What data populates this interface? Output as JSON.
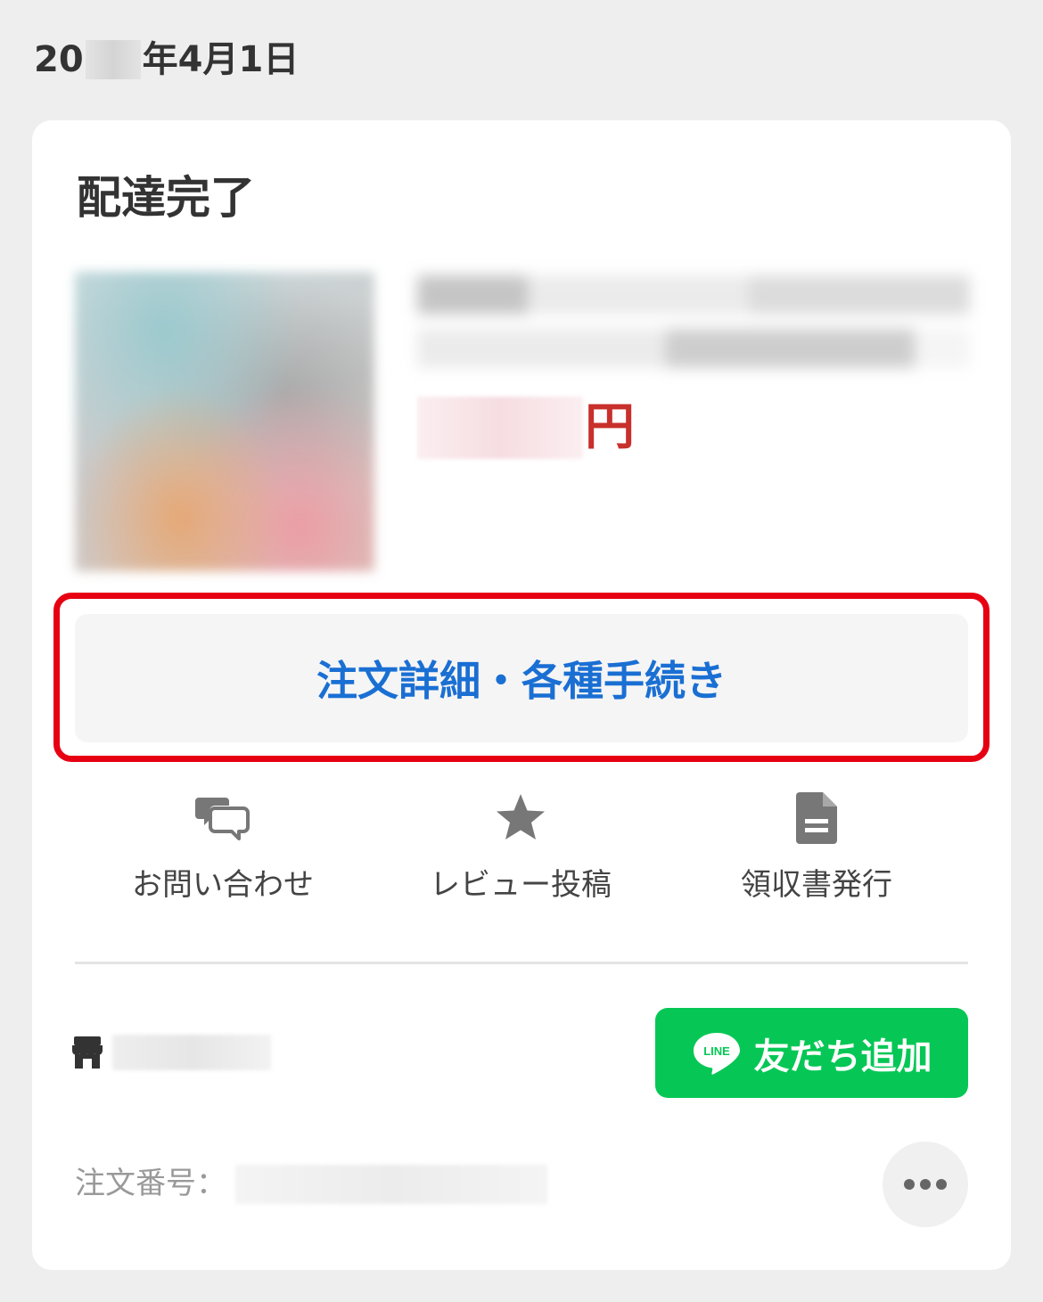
{
  "date_header": {
    "prefix": "20",
    "suffix": "年4月1日"
  },
  "order": {
    "status": "配達完了",
    "price_unit": "円",
    "detail_button_label": "注文詳細・各種手続き",
    "order_number_label": "注文番号："
  },
  "actions": [
    {
      "label": "お問い合わせ",
      "icon": "chat-bubbles-icon"
    },
    {
      "label": "レビュー投稿",
      "icon": "star-icon"
    },
    {
      "label": "領収書発行",
      "icon": "document-icon"
    }
  ],
  "store": {
    "icon": "store-icon"
  },
  "line_button": {
    "label": "友だち追加",
    "logo_text": "LINE",
    "color": "#06c755"
  },
  "colors": {
    "link_blue": "#1a6fd3",
    "price_red": "#c8302c",
    "highlight_red": "#e60012",
    "icon_gray": "#777777"
  }
}
